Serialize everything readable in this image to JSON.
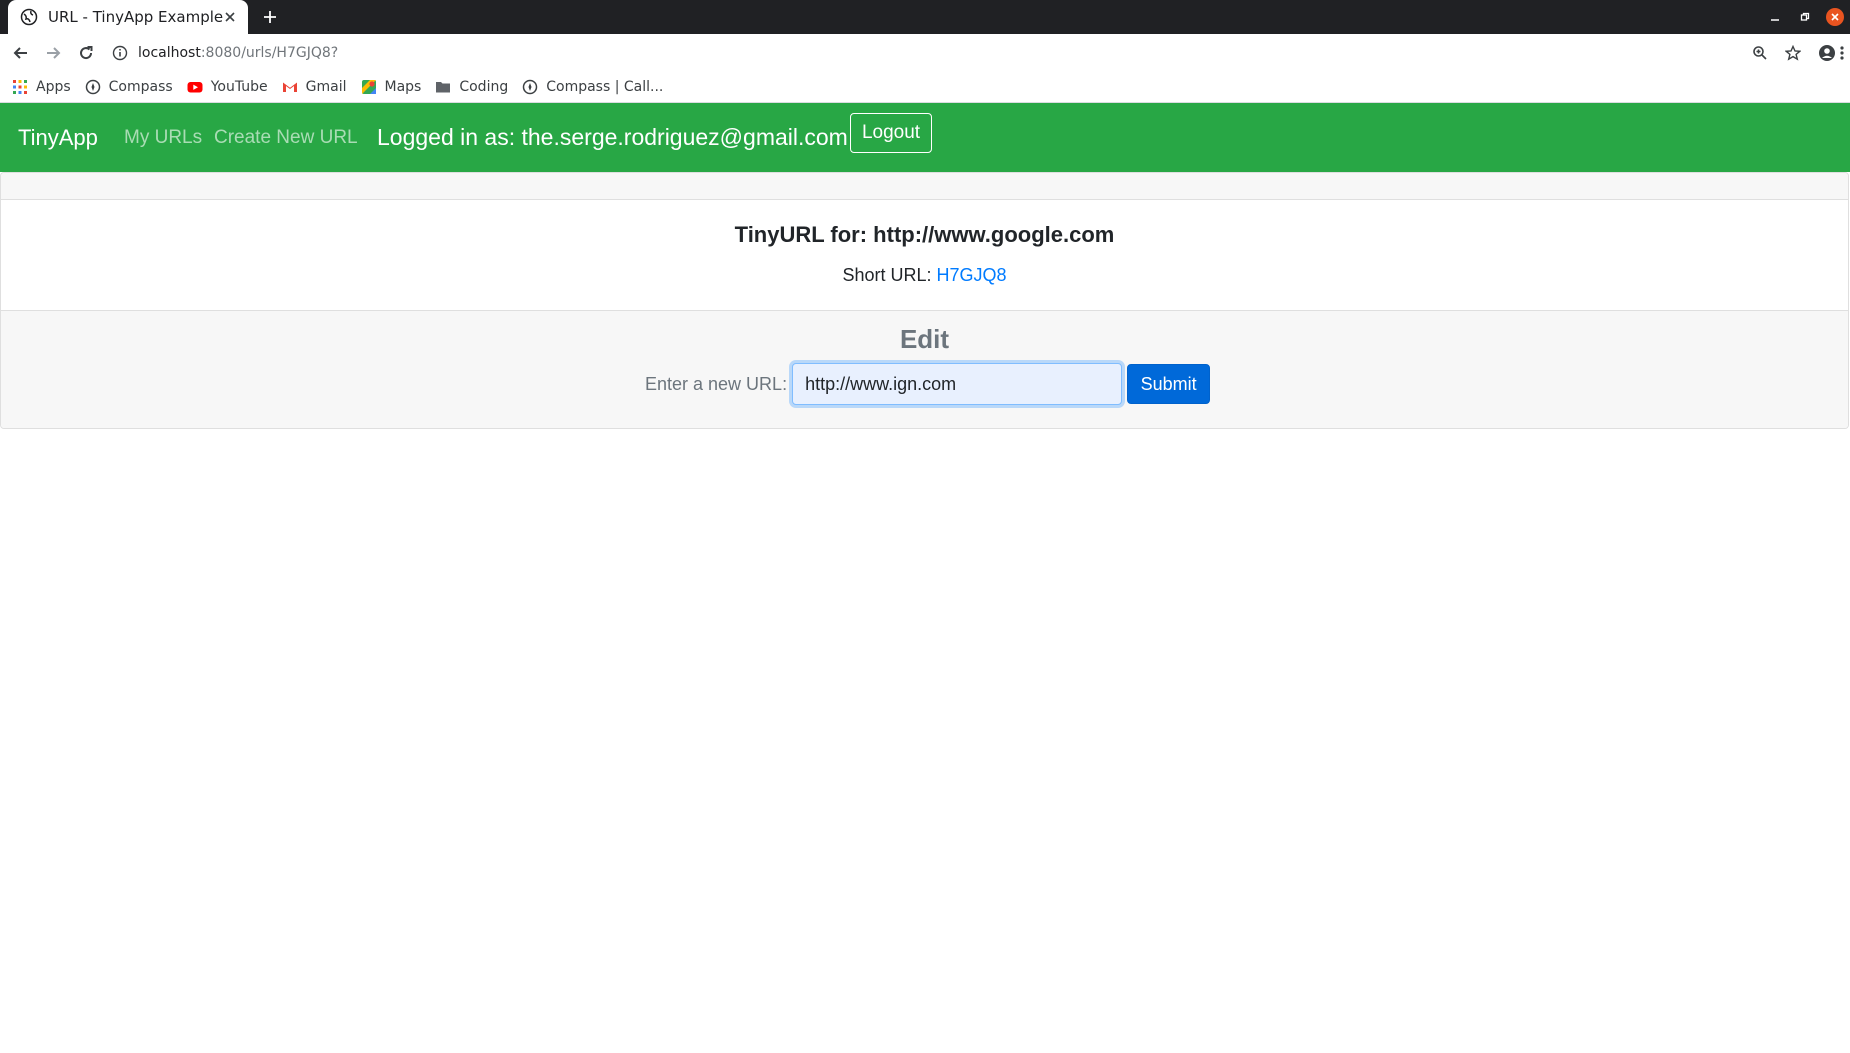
{
  "browser": {
    "tab_title": "URL - TinyApp Example",
    "url_host": "localhost",
    "url_path": ":8080/urls/H7GJQ8?",
    "bookmarks": [
      {
        "label": "Apps",
        "icon": "apps-grid-icon"
      },
      {
        "label": "Compass",
        "icon": "compass-icon"
      },
      {
        "label": "YouTube",
        "icon": "youtube-icon"
      },
      {
        "label": "Gmail",
        "icon": "gmail-icon"
      },
      {
        "label": "Maps",
        "icon": "maps-icon"
      },
      {
        "label": "Coding",
        "icon": "folder-icon"
      },
      {
        "label": "Compass | Call...",
        "icon": "compass-icon"
      }
    ]
  },
  "navbar": {
    "brand": "TinyApp",
    "links": [
      "My URLs",
      "Create New URL"
    ],
    "logged_in": "Logged in as: the.serge.rodriguez@gmail.com",
    "logout": "Logout",
    "bg_color": "#28a745"
  },
  "card": {
    "title": "TinyURL for: http://www.google.com",
    "short_url_label": "Short URL:",
    "short_url_value": "H7GJQ8",
    "edit_title": "Edit",
    "form_label": "Enter a new URL:",
    "input_value": "http://www.ign.com",
    "submit": "Submit"
  }
}
